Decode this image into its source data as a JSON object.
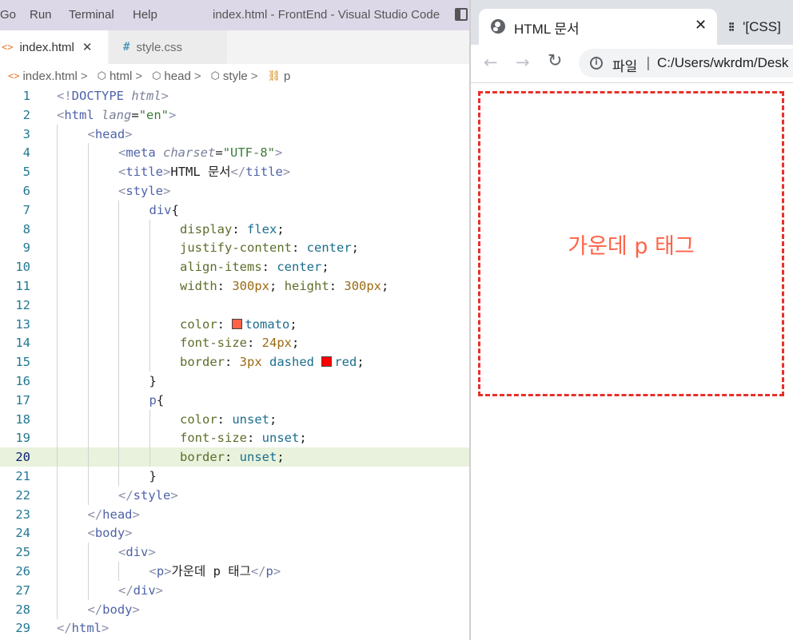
{
  "vscode": {
    "menu": [
      "Go",
      "Run",
      "Terminal",
      "Help"
    ],
    "window_title": "index.html - FrontEnd - Visual Studio Code",
    "tabs": [
      {
        "icon": "<>",
        "label": "index.html",
        "close": "✕",
        "active": true
      },
      {
        "icon": "#",
        "label": "style.css",
        "active": false
      }
    ],
    "breadcrumb": {
      "file_icon": "<>",
      "items": [
        "index.html",
        "html",
        "head",
        "style",
        "p"
      ],
      "sep": ">"
    },
    "current_line": 20,
    "colors": {
      "tomato": "#ff6347",
      "red": "#ff0000",
      "line_highlight": "#e8f2dc"
    },
    "lines": [
      {
        "n": "1",
        "indent": 0,
        "tokens": [
          [
            "<!",
            "angle"
          ],
          [
            "DOCTYPE ",
            "tag"
          ],
          [
            "html",
            "attrn-it"
          ],
          [
            ">",
            "angle"
          ]
        ]
      },
      {
        "n": "2",
        "indent": 0,
        "tokens": [
          [
            "<",
            "angle"
          ],
          [
            "html ",
            "tag"
          ],
          [
            "lang",
            "attrn-it"
          ],
          [
            "=",
            "txt"
          ],
          [
            "\"en\"",
            "attrv"
          ],
          [
            ">",
            "angle"
          ]
        ]
      },
      {
        "n": "3",
        "indent": 1,
        "tokens": [
          [
            "<",
            "angle"
          ],
          [
            "head",
            "tag"
          ],
          [
            ">",
            "angle"
          ]
        ]
      },
      {
        "n": "4",
        "indent": 2,
        "tokens": [
          [
            "<",
            "angle"
          ],
          [
            "meta ",
            "tag"
          ],
          [
            "charset",
            "attrn-it"
          ],
          [
            "=",
            "txt"
          ],
          [
            "\"UTF-8\"",
            "attrv"
          ],
          [
            ">",
            "angle"
          ]
        ]
      },
      {
        "n": "5",
        "indent": 2,
        "tokens": [
          [
            "<",
            "angle"
          ],
          [
            "title",
            "tag"
          ],
          [
            ">",
            "angle"
          ],
          [
            "HTML 문서",
            "txt"
          ],
          [
            "</",
            "angle"
          ],
          [
            "title",
            "tag"
          ],
          [
            ">",
            "angle"
          ]
        ]
      },
      {
        "n": "6",
        "indent": 2,
        "tokens": [
          [
            "<",
            "angle"
          ],
          [
            "style",
            "tag"
          ],
          [
            ">",
            "angle"
          ]
        ]
      },
      {
        "n": "7",
        "indent": 3,
        "tokens": [
          [
            "div",
            "tag"
          ],
          [
            "{",
            "txt"
          ]
        ]
      },
      {
        "n": "8",
        "indent": 4,
        "tokens": [
          [
            "display",
            "prop"
          ],
          [
            ": ",
            "txt"
          ],
          [
            "flex",
            "val"
          ],
          [
            ";",
            "txt"
          ]
        ]
      },
      {
        "n": "9",
        "indent": 4,
        "tokens": [
          [
            "justify-content",
            "prop"
          ],
          [
            ": ",
            "txt"
          ],
          [
            "center",
            "val"
          ],
          [
            ";",
            "txt"
          ]
        ]
      },
      {
        "n": "10",
        "indent": 4,
        "tokens": [
          [
            "align-items",
            "prop"
          ],
          [
            ": ",
            "txt"
          ],
          [
            "center",
            "val"
          ],
          [
            ";",
            "txt"
          ]
        ]
      },
      {
        "n": "11",
        "indent": 4,
        "tokens": [
          [
            "width",
            "prop"
          ],
          [
            ": ",
            "txt"
          ],
          [
            "300px",
            "num"
          ],
          [
            "; ",
            "txt"
          ],
          [
            "height",
            "prop"
          ],
          [
            ": ",
            "txt"
          ],
          [
            "300px",
            "num"
          ],
          [
            ";",
            "txt"
          ]
        ]
      },
      {
        "n": "12",
        "indent": 4,
        "tokens": []
      },
      {
        "n": "13",
        "indent": 4,
        "tokens": [
          [
            "color",
            "prop"
          ],
          [
            ": ",
            "txt"
          ],
          [
            "tomato",
            "swatch-tomato"
          ],
          [
            ";",
            "txt"
          ]
        ]
      },
      {
        "n": "14",
        "indent": 4,
        "tokens": [
          [
            "font-size",
            "prop"
          ],
          [
            ": ",
            "txt"
          ],
          [
            "24px",
            "num"
          ],
          [
            ";",
            "txt"
          ]
        ]
      },
      {
        "n": "15",
        "indent": 4,
        "tokens": [
          [
            "border",
            "prop"
          ],
          [
            ": ",
            "txt"
          ],
          [
            "3px",
            "num"
          ],
          [
            " dashed ",
            "val"
          ],
          [
            "red",
            "swatch-red"
          ],
          [
            ";",
            "txt"
          ]
        ]
      },
      {
        "n": "16",
        "indent": 3,
        "tokens": [
          [
            "}",
            "txt"
          ]
        ]
      },
      {
        "n": "17",
        "indent": 3,
        "tokens": [
          [
            "p",
            "tag"
          ],
          [
            "{",
            "txt"
          ]
        ]
      },
      {
        "n": "18",
        "indent": 4,
        "tokens": [
          [
            "color",
            "prop"
          ],
          [
            ": ",
            "txt"
          ],
          [
            "unset",
            "val"
          ],
          [
            ";",
            "txt"
          ]
        ]
      },
      {
        "n": "19",
        "indent": 4,
        "tokens": [
          [
            "font-size",
            "prop"
          ],
          [
            ": ",
            "txt"
          ],
          [
            "unset",
            "val"
          ],
          [
            ";",
            "txt"
          ]
        ]
      },
      {
        "n": "20",
        "indent": 4,
        "tokens": [
          [
            "border",
            "prop"
          ],
          [
            ": ",
            "txt"
          ],
          [
            "unset",
            "val"
          ],
          [
            ";",
            "txt"
          ]
        ]
      },
      {
        "n": "21",
        "indent": 3,
        "tokens": [
          [
            "}",
            "txt"
          ]
        ]
      },
      {
        "n": "22",
        "indent": 2,
        "tokens": [
          [
            "</",
            "angle"
          ],
          [
            "style",
            "tag"
          ],
          [
            ">",
            "angle"
          ]
        ]
      },
      {
        "n": "23",
        "indent": 1,
        "tokens": [
          [
            "</",
            "angle"
          ],
          [
            "head",
            "tag"
          ],
          [
            ">",
            "angle"
          ]
        ]
      },
      {
        "n": "24",
        "indent": 1,
        "tokens": [
          [
            "<",
            "angle"
          ],
          [
            "body",
            "tag"
          ],
          [
            ">",
            "angle"
          ]
        ]
      },
      {
        "n": "25",
        "indent": 2,
        "tokens": [
          [
            "<",
            "angle"
          ],
          [
            "div",
            "tag"
          ],
          [
            ">",
            "angle"
          ]
        ]
      },
      {
        "n": "26",
        "indent": 3,
        "tokens": [
          [
            "<",
            "angle"
          ],
          [
            "p",
            "tag"
          ],
          [
            ">",
            "angle"
          ],
          [
            "가운데 p 태그",
            "txt"
          ],
          [
            "</",
            "angle"
          ],
          [
            "p",
            "tag"
          ],
          [
            ">",
            "angle"
          ]
        ]
      },
      {
        "n": "27",
        "indent": 2,
        "tokens": [
          [
            "</",
            "angle"
          ],
          [
            "div",
            "tag"
          ],
          [
            ">",
            "angle"
          ]
        ]
      },
      {
        "n": "28",
        "indent": 1,
        "tokens": [
          [
            "</",
            "angle"
          ],
          [
            "body",
            "tag"
          ],
          [
            ">",
            "angle"
          ]
        ]
      },
      {
        "n": "29",
        "indent": 0,
        "tokens": [
          [
            "</",
            "angle"
          ],
          [
            "html",
            "tag"
          ],
          [
            ">",
            "angle"
          ]
        ]
      }
    ]
  },
  "browser": {
    "tab_title": "HTML 문서",
    "tab_close": "✕",
    "second_tab_title": "'[CSS]",
    "site_label": "파일",
    "site_sep": "|",
    "url": "C:/Users/wkrdm/Desk",
    "page": {
      "text": "가운데 p 태그",
      "text_color": "#ff6347",
      "border_color": "#e8302a"
    }
  }
}
